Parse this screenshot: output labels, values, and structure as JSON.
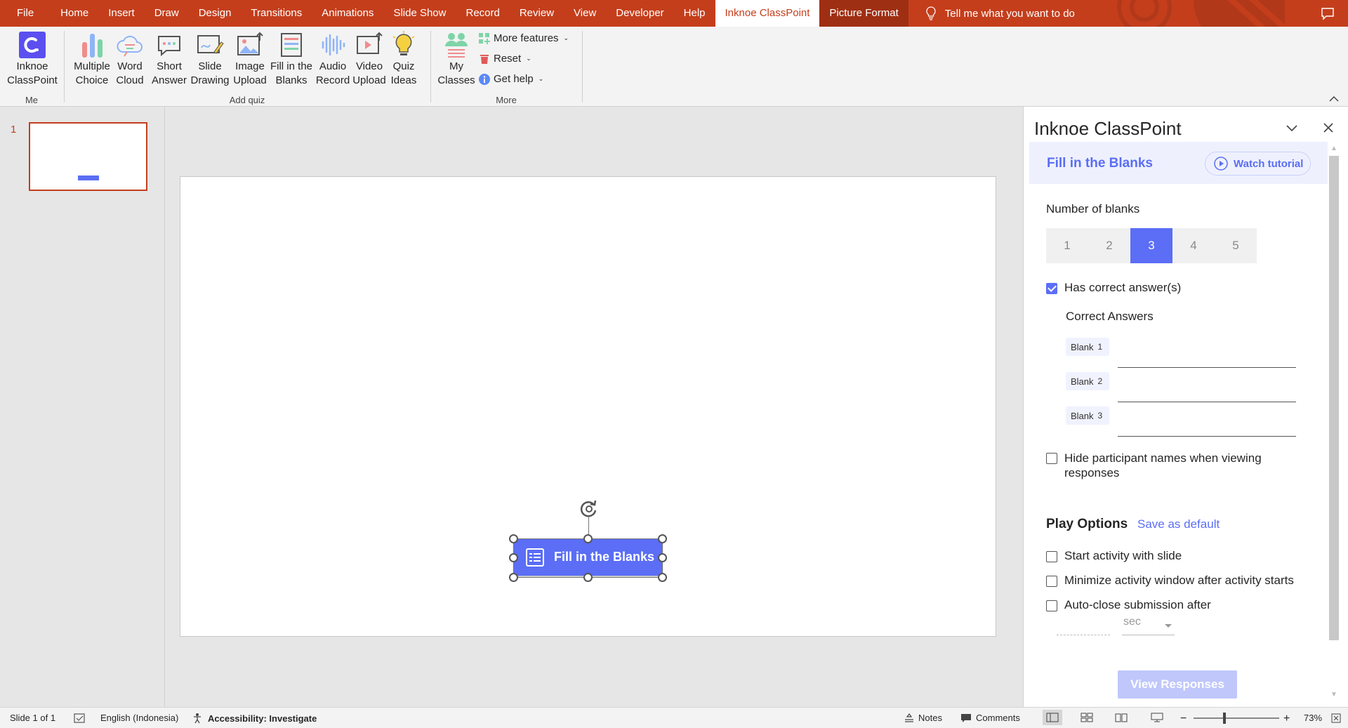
{
  "menu": {
    "tabs": [
      "File",
      "Home",
      "Insert",
      "Draw",
      "Design",
      "Transitions",
      "Animations",
      "Slide Show",
      "Record",
      "Review",
      "View",
      "Developer",
      "Help",
      "Inknoe ClassPoint",
      "Picture Format"
    ],
    "active_tab": "Inknoe ClassPoint",
    "tell_me": "Tell me what you want to do"
  },
  "ribbon": {
    "me_group": {
      "label": "Me",
      "button": [
        "Inknoe",
        "ClassPoint"
      ]
    },
    "addquiz_group": {
      "label": "Add quiz",
      "buttons": [
        {
          "l1": "Multiple",
          "l2": "Choice",
          "icon": "multiple-choice-icon"
        },
        {
          "l1": "Word",
          "l2": "Cloud",
          "icon": "word-cloud-icon"
        },
        {
          "l1": "Short",
          "l2": "Answer",
          "icon": "short-answer-icon"
        },
        {
          "l1": "Slide",
          "l2": "Drawing",
          "icon": "slide-drawing-icon"
        },
        {
          "l1": "Image",
          "l2": "Upload",
          "icon": "image-upload-icon"
        },
        {
          "l1": "Fill in the",
          "l2": "Blanks",
          "icon": "fill-blanks-icon"
        },
        {
          "l1": "Audio",
          "l2": "Record",
          "icon": "audio-record-icon"
        },
        {
          "l1": "Video",
          "l2": "Upload",
          "icon": "video-upload-icon"
        },
        {
          "l1": "Quiz",
          "l2": "Ideas",
          "icon": "quiz-ideas-icon"
        }
      ]
    },
    "more_group": {
      "label": "More",
      "my_classes": [
        "My",
        "Classes"
      ],
      "more_features": "More features",
      "reset": "Reset",
      "get_help": "Get help"
    }
  },
  "thumbnails": {
    "slide_number": "1"
  },
  "slide": {
    "button_text": "Fill in the Blanks"
  },
  "pane": {
    "title": "Inknoe ClassPoint",
    "header": "Fill in the Blanks",
    "watch_tutorial": "Watch tutorial",
    "number_of_blanks_label": "Number of blanks",
    "blank_options": [
      "1",
      "2",
      "3",
      "4",
      "5"
    ],
    "selected_blanks": "3",
    "has_correct_answers": "Has correct answer(s)",
    "correct_answers_label": "Correct Answers",
    "blank_label": "Blank",
    "blank_nums": [
      "1",
      "2",
      "3"
    ],
    "hide_names": "Hide participant names when viewing responses",
    "play_options": "Play Options",
    "save_as_default": "Save as default",
    "start_with_slide": "Start activity with slide",
    "minimize_window": "Minimize activity window after activity starts",
    "auto_close": "Auto-close submission after",
    "sec_unit": "sec",
    "view_responses": "View Responses"
  },
  "status": {
    "slide_info": "Slide 1 of 1",
    "language": "English (Indonesia)",
    "accessibility": "Accessibility: Investigate",
    "notes": "Notes",
    "comments": "Comments",
    "zoom": "73%"
  },
  "colors": {
    "brand": "#c43e1c",
    "accent": "#5b6ef5"
  }
}
